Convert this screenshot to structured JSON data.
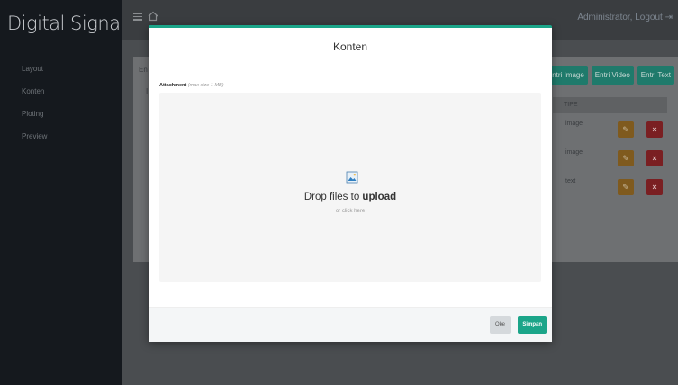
{
  "app": {
    "brand": "Digital Signage"
  },
  "sidebar": {
    "items": [
      {
        "label": "Layout"
      },
      {
        "label": "Konten"
      },
      {
        "label": "Ploting"
      },
      {
        "label": "Preview"
      }
    ]
  },
  "header": {
    "user_text": "Administrator, Logout",
    "icons": [
      "menu-icon",
      "home-icon",
      "logout-icon"
    ]
  },
  "background_page": {
    "card_title_stub": "En",
    "card_sub_stub": "I",
    "buttons": [
      "Entri Image",
      "Entri Video",
      "Entri Text"
    ],
    "table": {
      "header": "TIPE",
      "rows": [
        {
          "tipe": "image"
        },
        {
          "tipe": "image"
        },
        {
          "tipe": "text"
        }
      ]
    }
  },
  "modal": {
    "title": "Konten",
    "attachment_label": "Attachment",
    "attachment_hint": "(max size 1 MB)",
    "dropzone_text_prefix": "Drop files to ",
    "dropzone_text_bold": "upload",
    "dropzone_subtext": "or click here",
    "ok_label": "Oke",
    "save_label": "Simpan",
    "accent_color": "#1ba589"
  }
}
